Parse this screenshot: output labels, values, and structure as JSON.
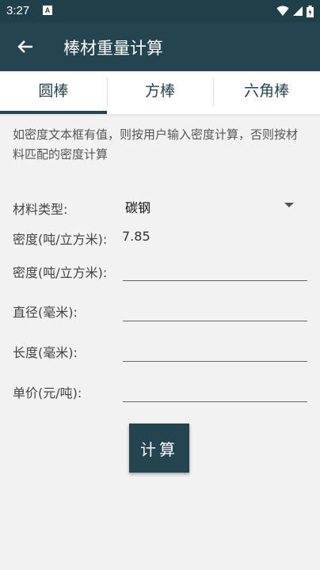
{
  "status": {
    "time": "3:27",
    "notif_letter": "A"
  },
  "appbar": {
    "title": "棒材重量计算"
  },
  "tabs": [
    {
      "label": "圆棒"
    },
    {
      "label": "方棒"
    },
    {
      "label": "六角棒"
    }
  ],
  "hint": "如密度文本框有值，则按用户输入密度计算，否则按材料匹配的密度计算",
  "material": {
    "label": "材料类型:",
    "value": "碳钢"
  },
  "density_display": {
    "label": "密度(吨/立方米):",
    "value": "7.85"
  },
  "fields": {
    "density": {
      "label": "密度(吨/立方米):",
      "value": ""
    },
    "diameter": {
      "label": "直径(毫米):",
      "value": ""
    },
    "length": {
      "label": "长度(毫米):",
      "value": ""
    },
    "price": {
      "label": "单价(元/吨):",
      "value": ""
    }
  },
  "calc_button": "计算",
  "colors": {
    "primary": "#24444f",
    "statusbar": "#1f3f49",
    "background": "#f2f2f2"
  }
}
